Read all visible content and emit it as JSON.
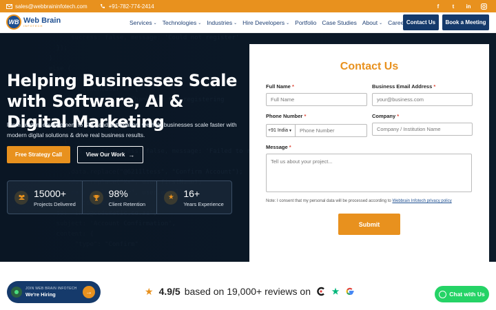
{
  "topbar": {
    "email": "sales@webbraininfotech.com",
    "phone": "+91-782-774-2414",
    "socials": [
      "f",
      "t",
      "in",
      "ig"
    ]
  },
  "brand": {
    "name": "Web Brain",
    "tagline": "INFOTECH"
  },
  "nav": {
    "items": [
      {
        "label": "Services",
        "dropdown": true
      },
      {
        "label": "Technologies",
        "dropdown": true
      },
      {
        "label": "Industries",
        "dropdown": true
      },
      {
        "label": "Hire Developers",
        "dropdown": true
      },
      {
        "label": "Portfolio",
        "dropdown": false
      },
      {
        "label": "Case Studies",
        "dropdown": false
      },
      {
        "label": "About",
        "dropdown": true
      },
      {
        "label": "Careers",
        "dropdown": false
      }
    ],
    "contact_btn": "Contact Us",
    "meeting_btn": "Book a Meeting"
  },
  "hero": {
    "title": "Helping Businesses Scale with Software, AI & Digital Marketing",
    "subtitle": "From custom development to SEO and automation, we help businesses scale faster with modern digital solutions & drive real business results.",
    "primary_btn": "Free Strategy Call",
    "secondary_btn": "View Our Work",
    "stats": [
      {
        "number": "15000+",
        "label": "Projects Delivered",
        "icon": "people-icon"
      },
      {
        "number": "98%",
        "label": "Client Retention",
        "icon": "trophy-icon"
      },
      {
        "number": "16+",
        "label": "Years Experience",
        "icon": "star-icon"
      }
    ]
  },
  "form": {
    "title": "Contact Us",
    "full_name_label": "Full Name",
    "full_name_placeholder": "Full Name",
    "email_label": "Business Email Address",
    "email_placeholder": "your@business.com",
    "phone_label": "Phone Number",
    "phone_code": "+91 India",
    "phone_placeholder": "Phone Number",
    "company_label": "Company",
    "company_placeholder": "Company / Institution Name",
    "message_label": "Message",
    "message_placeholder": "Tell us about your project...",
    "consent_text": "Note: I consent that my personal data will be processed according to",
    "consent_link": "Webbrain Infotech privacy policy",
    "required_mark": "*",
    "submit_label": "Submit"
  },
  "hiring": {
    "line1": "JOIN WEB BRAIN INFOTECH",
    "line2": "We're Hiring"
  },
  "reviews": {
    "score": "4.9/5",
    "text": "based on 19,000+ reviews on"
  },
  "chat": {
    "label": "Chat with Us"
  },
  "colors": {
    "accent": "#e8911e",
    "navy": "#153a6b",
    "hero_bg": "#0d1b2a",
    "whatsapp": "#25d366"
  }
}
